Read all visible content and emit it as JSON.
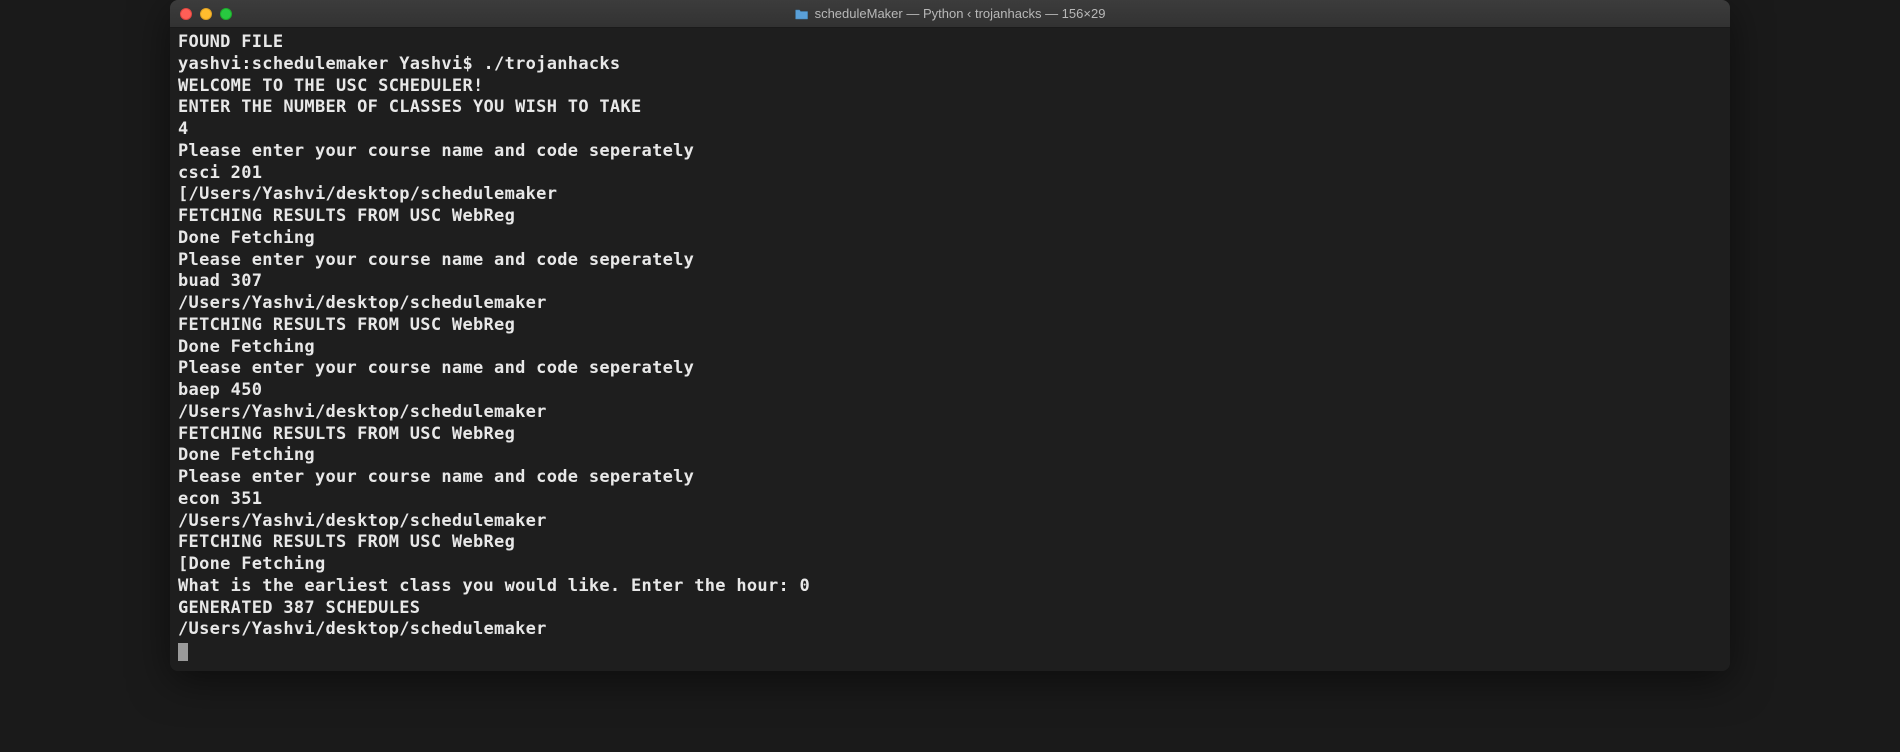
{
  "window": {
    "title": "scheduleMaker — Python ‹ trojanhacks — 156×29"
  },
  "terminal": {
    "lines": [
      "FOUND FILE",
      "yashvi:schedulemaker Yashvi$ ./trojanhacks",
      "WELCOME TO THE USC SCHEDULER!",
      "ENTER THE NUMBER OF CLASSES YOU WISH TO TAKE",
      "4",
      "Please enter your course name and code seperately",
      "csci 201",
      "[/Users/Yashvi/desktop/schedulemaker",
      "FETCHING RESULTS FROM USC WebReg",
      "Done Fetching",
      "Please enter your course name and code seperately",
      "buad 307",
      "/Users/Yashvi/desktop/schedulemaker",
      "FETCHING RESULTS FROM USC WebReg",
      "Done Fetching",
      "Please enter your course name and code seperately",
      "baep 450",
      "/Users/Yashvi/desktop/schedulemaker",
      "FETCHING RESULTS FROM USC WebReg",
      "Done Fetching",
      "Please enter your course name and code seperately",
      "econ 351",
      "/Users/Yashvi/desktop/schedulemaker",
      "FETCHING RESULTS FROM USC WebReg",
      "[Done Fetching",
      "What is the earliest class you would like. Enter the hour: 0",
      "GENERATED 387 SCHEDULES",
      "/Users/Yashvi/desktop/schedulemaker"
    ]
  }
}
